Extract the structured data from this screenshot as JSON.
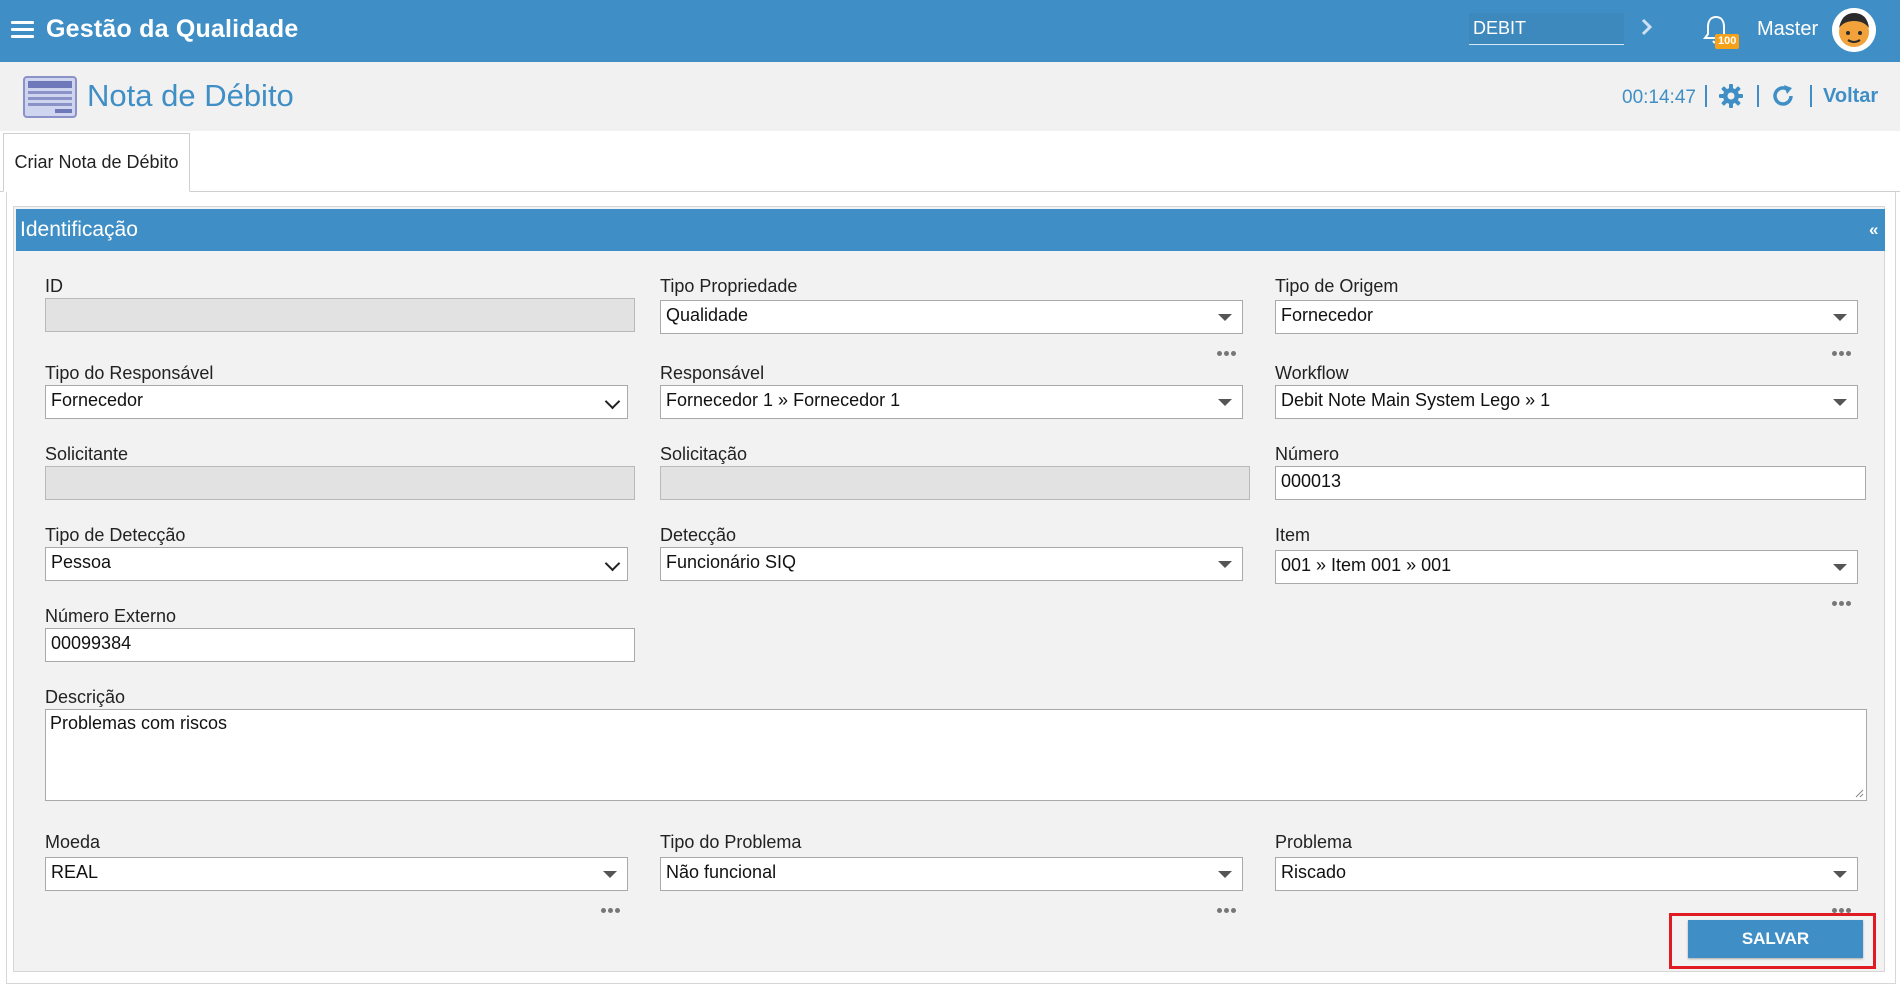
{
  "app": {
    "title": "Gestão da Qualidade"
  },
  "header": {
    "search_value": "DEBIT",
    "notification_count": "100",
    "user_name": "Master"
  },
  "page": {
    "title": "Nota de Débito",
    "timer": "00:14:47",
    "back_label": "Voltar"
  },
  "tabs": [
    {
      "label": "Criar Nota de Débito"
    }
  ],
  "section": {
    "title": "Identificação",
    "collapse_glyph": "«"
  },
  "form": {
    "id": {
      "label": "ID",
      "value": ""
    },
    "tipo_propriedade": {
      "label": "Tipo Propriedade",
      "value": "Qualidade"
    },
    "tipo_origem": {
      "label": "Tipo de Origem",
      "value": "Fornecedor"
    },
    "tipo_responsavel": {
      "label": "Tipo do Responsável",
      "value": "Fornecedor"
    },
    "responsavel": {
      "label": "Responsável",
      "value": "Fornecedor 1 » Fornecedor 1"
    },
    "workflow": {
      "label": "Workflow",
      "value": "Debit Note Main System Lego » 1"
    },
    "solicitante": {
      "label": "Solicitante",
      "value": ""
    },
    "solicitacao": {
      "label": "Solicitação",
      "value": ""
    },
    "numero": {
      "label": "Número",
      "value": "000013"
    },
    "tipo_deteccao": {
      "label": "Tipo de Detecção",
      "value": "Pessoa"
    },
    "deteccao": {
      "label": "Detecção",
      "value": "Funcionário SIQ"
    },
    "item": {
      "label": "Item",
      "value": "001 » Item 001 » 001"
    },
    "numero_externo": {
      "label": "Número Externo",
      "value": "00099384"
    },
    "descricao": {
      "label": "Descrição",
      "value": "Problemas com riscos"
    },
    "moeda": {
      "label": "Moeda",
      "value": "REAL"
    },
    "tipo_problema": {
      "label": "Tipo do Problema",
      "value": "Não funcional"
    },
    "problema": {
      "label": "Problema",
      "value": "Riscado"
    }
  },
  "actions": {
    "save_label": "SALVAR"
  },
  "colors": {
    "primary": "#3f8fc6",
    "highlight": "#e01b24",
    "badge": "#f5a21a"
  }
}
